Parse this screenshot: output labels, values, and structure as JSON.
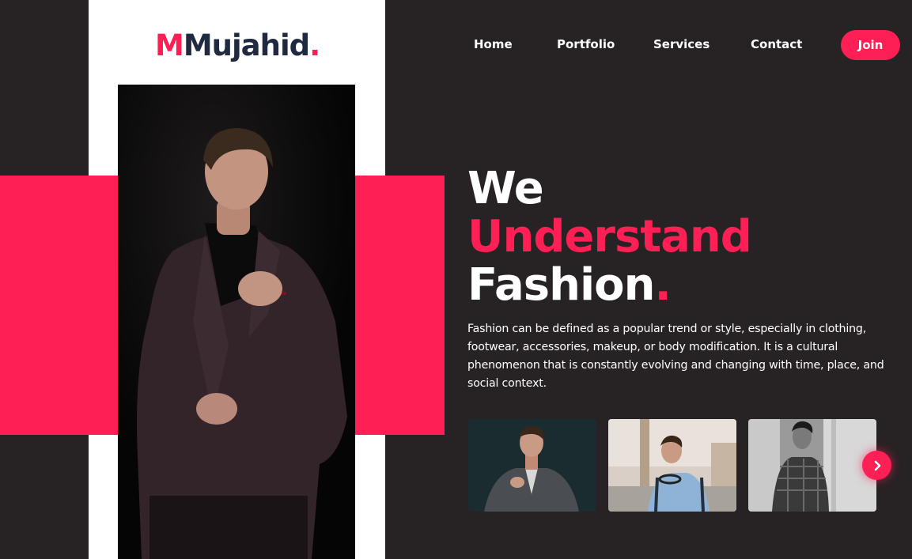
{
  "logo": {
    "initial": "M",
    "name": "Mujahid",
    "dot": "."
  },
  "nav": {
    "items": [
      "Home",
      "Portfolio",
      "Services",
      "Contact"
    ],
    "join_label": "Join"
  },
  "hero": {
    "line1": "We",
    "line2": "Understand",
    "line3": "Fashion",
    "line3_dot": ".",
    "description": "Fashion can be defined as a popular trend or style, especially in clothing, footwear, accessories, makeup, or body modification. It is a cultural phenomenon that is constantly evolving and changing with time, place, and social context."
  },
  "gallery": {
    "thumbnails": [
      "man-in-grey-suit",
      "man-with-headphones-outdoors",
      "man-in-plaid-shirt-bw"
    ],
    "next_icon": "chevron-right-icon"
  },
  "colors": {
    "accent": "#fe1f55",
    "background": "#272224",
    "logo_text": "#1f2a40",
    "panel": "#ffffff"
  }
}
